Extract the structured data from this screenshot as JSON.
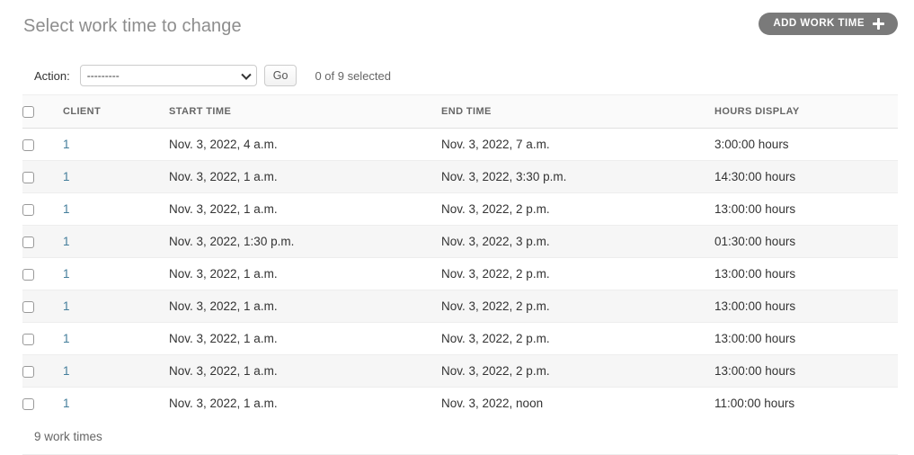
{
  "header": {
    "title": "Select work time to change",
    "add_button_label": "ADD WORK TIME",
    "add_button_icon": "plus-icon",
    "add_button_color": "#7a7a7a"
  },
  "actions": {
    "label": "Action:",
    "selected_option": "---------",
    "options": [
      "---------"
    ],
    "go_label": "Go",
    "counter": "0 of 9 selected",
    "chevron_icon": "chevron-down-icon"
  },
  "table": {
    "columns": [
      "CLIENT",
      "START TIME",
      "END TIME",
      "HOURS DISPLAY"
    ],
    "select_all_checkbox": "unchecked",
    "rows": [
      {
        "checked": false,
        "client": "1",
        "start_time": "Nov. 3, 2022, 4 a.m.",
        "end_time": "Nov. 3, 2022, 7 a.m.",
        "hours_display": "3:00:00 hours"
      },
      {
        "checked": false,
        "client": "1",
        "start_time": "Nov. 3, 2022, 1 a.m.",
        "end_time": "Nov. 3, 2022, 3:30 p.m.",
        "hours_display": "14:30:00 hours"
      },
      {
        "checked": false,
        "client": "1",
        "start_time": "Nov. 3, 2022, 1 a.m.",
        "end_time": "Nov. 3, 2022, 2 p.m.",
        "hours_display": "13:00:00 hours"
      },
      {
        "checked": false,
        "client": "1",
        "start_time": "Nov. 3, 2022, 1:30 p.m.",
        "end_time": "Nov. 3, 2022, 3 p.m.",
        "hours_display": "01:30:00 hours"
      },
      {
        "checked": false,
        "client": "1",
        "start_time": "Nov. 3, 2022, 1 a.m.",
        "end_time": "Nov. 3, 2022, 2 p.m.",
        "hours_display": "13:00:00 hours"
      },
      {
        "checked": false,
        "client": "1",
        "start_time": "Nov. 3, 2022, 1 a.m.",
        "end_time": "Nov. 3, 2022, 2 p.m.",
        "hours_display": "13:00:00 hours"
      },
      {
        "checked": false,
        "client": "1",
        "start_time": "Nov. 3, 2022, 1 a.m.",
        "end_time": "Nov. 3, 2022, 2 p.m.",
        "hours_display": "13:00:00 hours"
      },
      {
        "checked": false,
        "client": "1",
        "start_time": "Nov. 3, 2022, 1 a.m.",
        "end_time": "Nov. 3, 2022, 2 p.m.",
        "hours_display": "13:00:00 hours"
      },
      {
        "checked": false,
        "client": "1",
        "start_time": "Nov. 3, 2022, 1 a.m.",
        "end_time": "Nov. 3, 2022, noon",
        "hours_display": "11:00:00 hours"
      }
    ]
  },
  "paginator": {
    "count_label": "9 work times"
  },
  "colors": {
    "link": "#447e9b",
    "title": "#8d8d8d",
    "row_alt_background": "#f6f6f6",
    "header_background": "#fafafa"
  }
}
